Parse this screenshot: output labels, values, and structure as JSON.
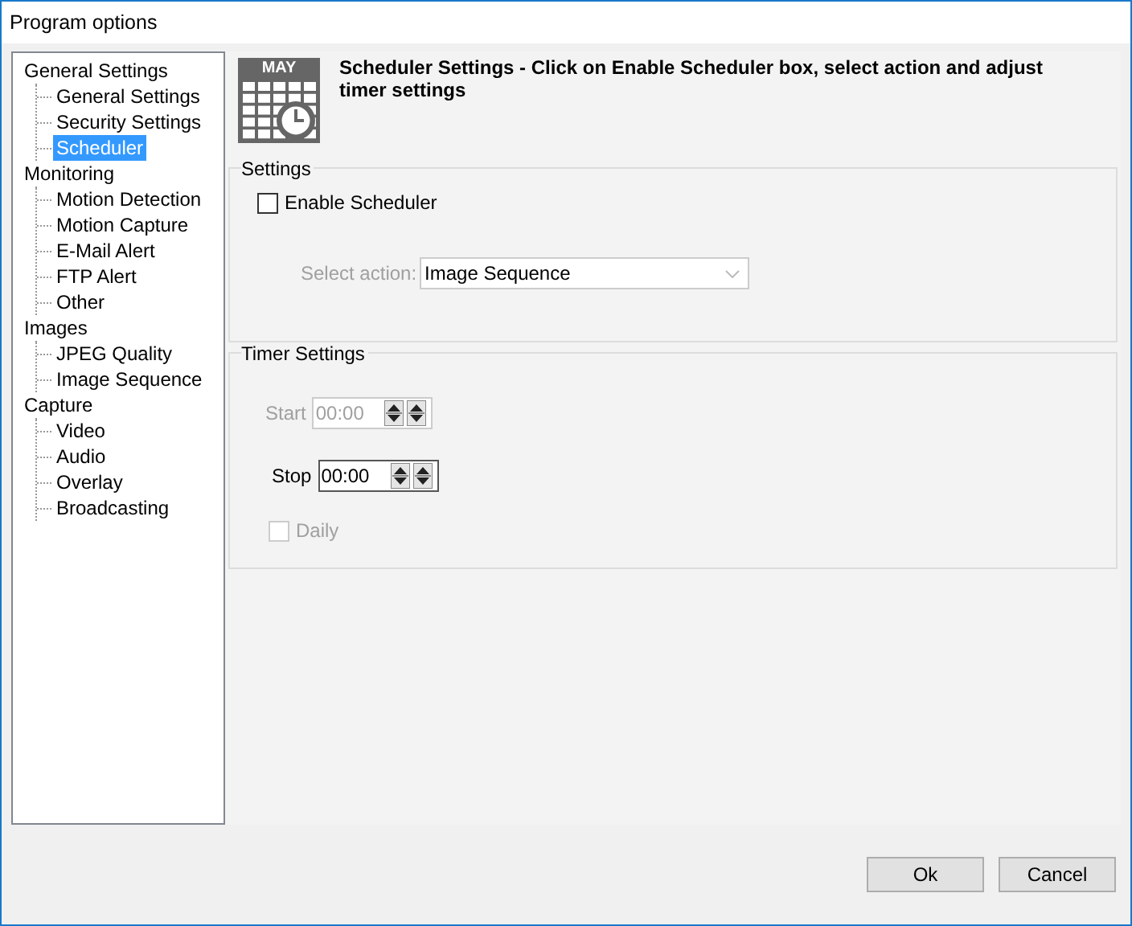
{
  "window": {
    "title": "Program options"
  },
  "tree": [
    {
      "label": "General Settings",
      "selected": false,
      "children": [
        {
          "label": "General Settings",
          "selected": false
        },
        {
          "label": "Security Settings",
          "selected": false
        },
        {
          "label": "Scheduler",
          "selected": true
        }
      ]
    },
    {
      "label": "Monitoring",
      "selected": false,
      "children": [
        {
          "label": "Motion Detection",
          "selected": false
        },
        {
          "label": "Motion Capture",
          "selected": false
        },
        {
          "label": "E-Mail Alert",
          "selected": false
        },
        {
          "label": "FTP Alert",
          "selected": false
        },
        {
          "label": "Other",
          "selected": false
        }
      ]
    },
    {
      "label": "Images",
      "selected": false,
      "children": [
        {
          "label": "JPEG Quality",
          "selected": false
        },
        {
          "label": "Image Sequence",
          "selected": false
        }
      ]
    },
    {
      "label": "Capture",
      "selected": false,
      "children": [
        {
          "label": "Video",
          "selected": false
        },
        {
          "label": "Audio",
          "selected": false
        },
        {
          "label": "Overlay",
          "selected": false
        },
        {
          "label": "Broadcasting",
          "selected": false
        }
      ]
    }
  ],
  "header": {
    "icon_text": "MAY",
    "title": "Scheduler Settings - Click on Enable Scheduler box, select action and adjust timer settings"
  },
  "settings": {
    "title": "Settings",
    "enable": {
      "label": "Enable Scheduler",
      "checked": false
    },
    "action": {
      "label": "Select action:",
      "value": "Image Sequence",
      "disabled": true
    }
  },
  "timer": {
    "title": "Timer Settings",
    "times": [
      {
        "label": "Start",
        "value": "00:00",
        "disabled": true
      },
      {
        "label": "Stop",
        "value": "00:00",
        "disabled": false
      }
    ],
    "daily": {
      "label": "Daily",
      "checked": false,
      "disabled": true
    }
  },
  "buttons": [
    "Ok",
    "Cancel"
  ]
}
